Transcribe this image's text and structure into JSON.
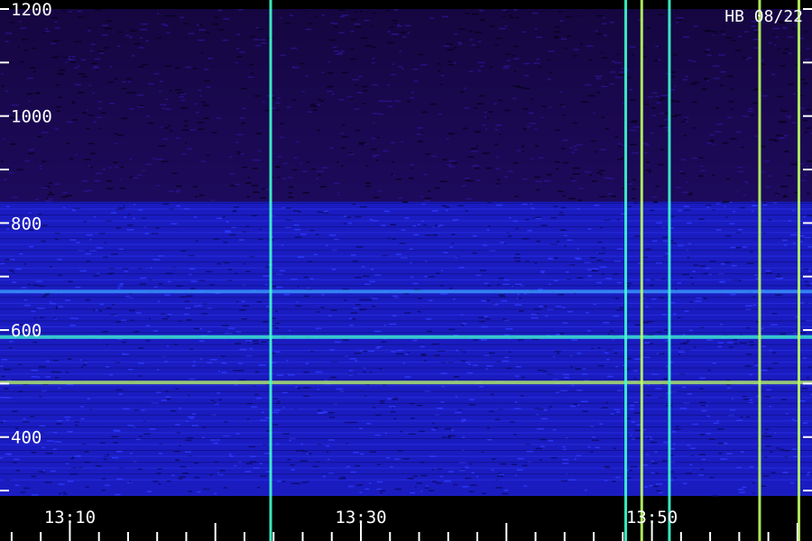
{
  "chart_data": {
    "type": "heatmap",
    "station_label": "HB 08/22",
    "y_axis": {
      "ylim": [
        290,
        1200
      ],
      "ticks": [
        1200,
        1000,
        800,
        600,
        400
      ],
      "minor_ticks": [
        1100,
        900,
        700,
        500,
        300
      ]
    },
    "x_axis": {
      "ticks": [
        "13:10",
        "13:30",
        "13:50"
      ],
      "tick_minutes": [
        10,
        30,
        50
      ],
      "range_minutes": [
        5.2,
        61.0
      ]
    },
    "colormap": [
      "#0a0030",
      "#20107a",
      "#2a22e0",
      "#3aa0ff",
      "#40ffd0",
      "#c0ff60"
    ],
    "horizontal_bands": [
      {
        "freq": 587,
        "level": 0.72
      },
      {
        "freq": 502,
        "level": 0.95
      },
      {
        "freq": 672,
        "level": 0.55
      }
    ],
    "vertical_events": [
      {
        "time_minutes": 23.8,
        "level": 0.85
      },
      {
        "time_minutes": 48.2,
        "level": 0.75
      },
      {
        "time_minutes": 49.3,
        "level": 0.9
      },
      {
        "time_minutes": 51.2,
        "level": 0.8
      },
      {
        "time_minutes": 57.4,
        "level": 1.0
      },
      {
        "time_minutes": 60.1,
        "level": 1.0
      }
    ]
  }
}
